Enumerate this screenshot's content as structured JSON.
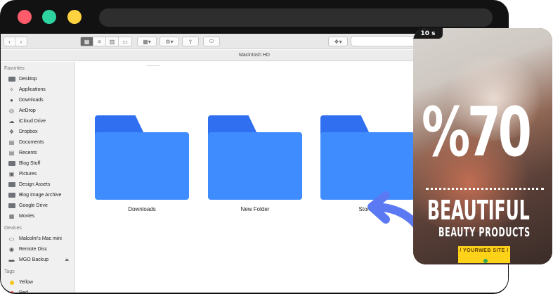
{
  "window": {
    "title": "Macintosh HD"
  },
  "sidebar": {
    "sections": [
      {
        "heading": "Favorites",
        "items": [
          {
            "label": "Desktop",
            "icon": "desktop-icon"
          },
          {
            "label": "Applications",
            "icon": "applications-icon"
          },
          {
            "label": "Downloads",
            "icon": "downloads-icon"
          },
          {
            "label": "AirDrop",
            "icon": "airdrop-icon"
          },
          {
            "label": "iCloud Drive",
            "icon": "cloud-icon"
          },
          {
            "label": "Dropbox",
            "icon": "dropbox-icon"
          },
          {
            "label": "Documents",
            "icon": "documents-icon"
          },
          {
            "label": "Recents",
            "icon": "recents-icon"
          },
          {
            "label": "Blog Stuff",
            "icon": "folder-icon"
          },
          {
            "label": "Pictures",
            "icon": "camera-icon"
          },
          {
            "label": "Design Assets",
            "icon": "folder-icon"
          },
          {
            "label": "Blog Image Archive",
            "icon": "folder-icon"
          },
          {
            "label": "Google Drive",
            "icon": "folder-icon"
          },
          {
            "label": "Movies",
            "icon": "movies-icon"
          }
        ]
      },
      {
        "heading": "Devices",
        "items": [
          {
            "label": "Malcolm's Mac mini",
            "icon": "computer-icon"
          },
          {
            "label": "Remote Disc",
            "icon": "disc-icon"
          },
          {
            "label": "MGO Backup",
            "icon": "drive-icon",
            "eject": "⏏"
          }
        ]
      },
      {
        "heading": "Tags",
        "items": [
          {
            "label": "Yellow",
            "icon": "tag-dot-icon",
            "color": "#f5c518"
          },
          {
            "label": "Red",
            "icon": "tag-dot-icon",
            "color": "#ff4b4b"
          }
        ]
      }
    ]
  },
  "folders": [
    {
      "name": "Downloads"
    },
    {
      "name": "New Folder"
    },
    {
      "name": "Stories"
    }
  ],
  "promo": {
    "timer": "10 s",
    "headline": "%70",
    "title": "BEAUTIFUL",
    "subtitle": "BEAUTY PRODUCTS",
    "website": "/ YOURWEB SITE /"
  },
  "colors": {
    "folder_tab": "#2f6ff0",
    "folder_body": "#3f8cff",
    "arrow": "#5b79f2",
    "accent_yellow": "#ffd21a"
  }
}
